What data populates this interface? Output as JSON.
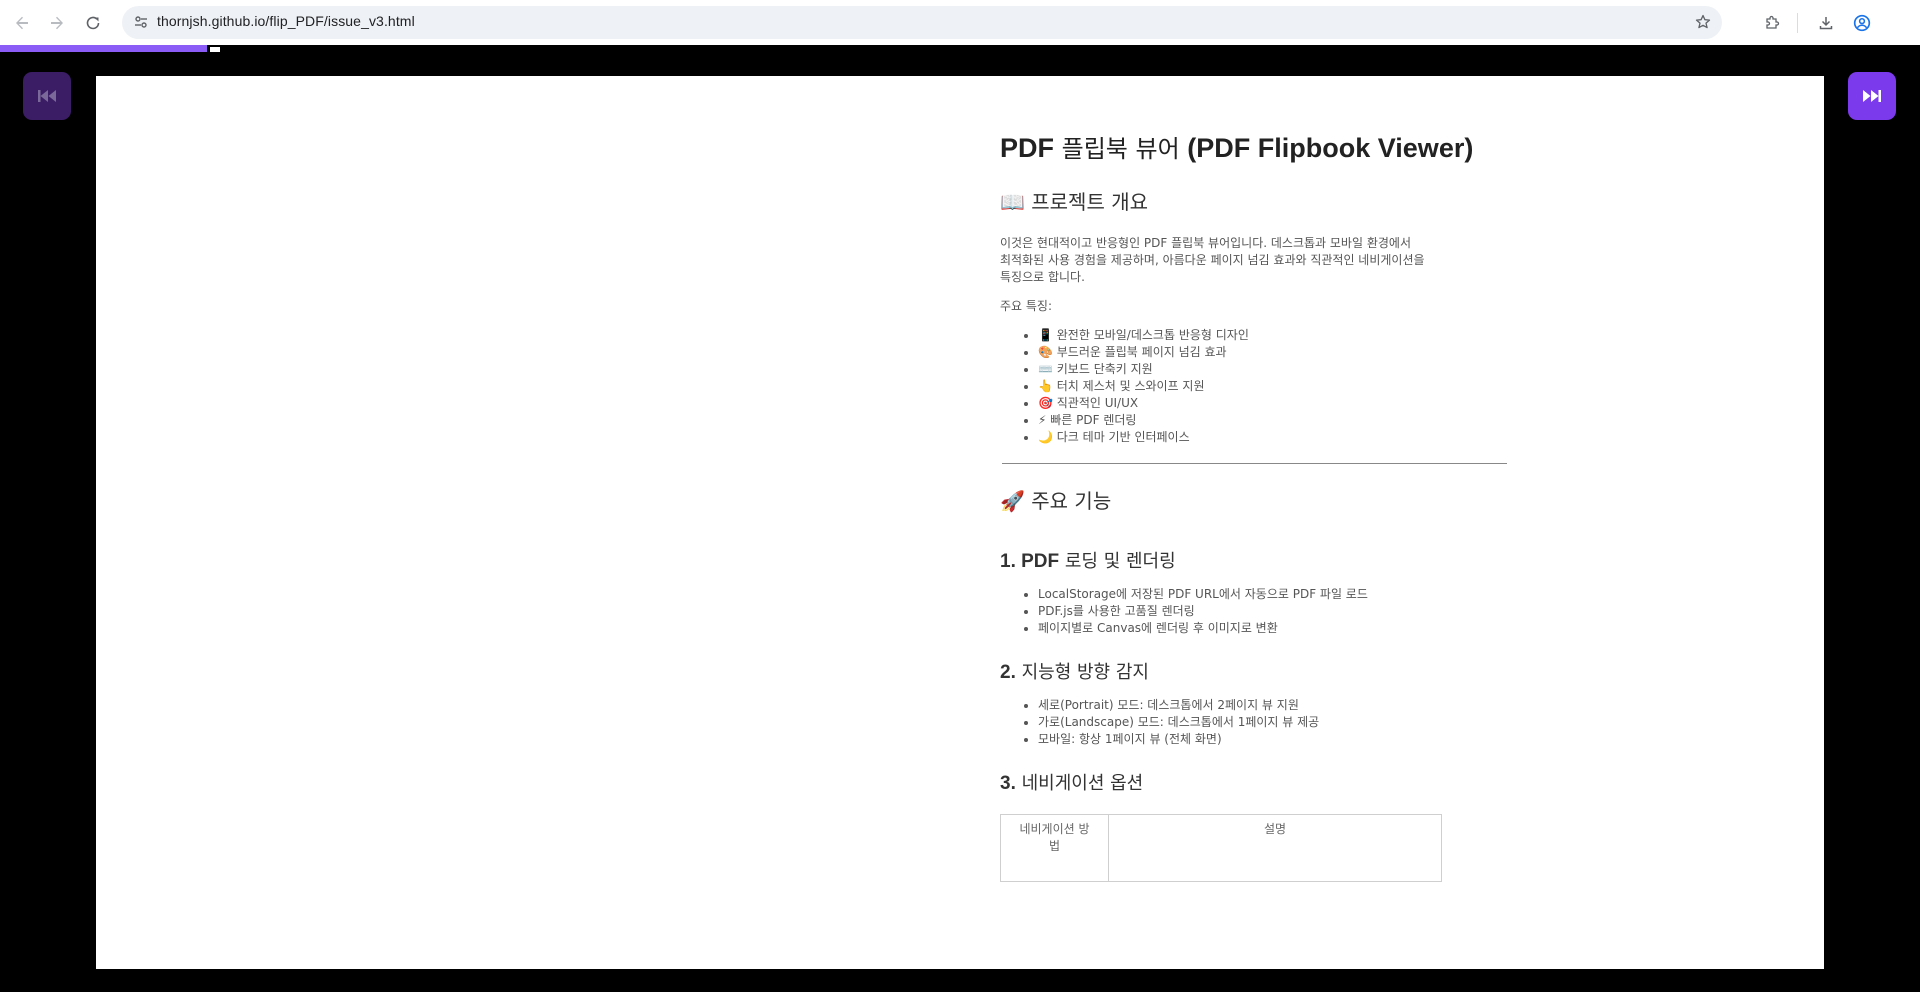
{
  "browser": {
    "url": "thornjsh.github.io/flip_PDF/issue_v3.html",
    "icons": {
      "back": "arrow-left-icon",
      "forward": "arrow-right-icon",
      "reload": "reload-icon",
      "site_info": "tune-icon",
      "bookmark": "star-icon",
      "extensions": "puzzle-icon",
      "downloads": "download-icon",
      "profile": "account-circle-icon"
    }
  },
  "progress": {
    "fraction": 0.108,
    "color": "#8b5cf6"
  },
  "controls": {
    "prev_icon": "skip-back-icon",
    "next_icon": "skip-forward-icon",
    "prev_color": "#3b1d66",
    "next_color": "#7c3aed"
  },
  "doc": {
    "title_bold_1": "PDF",
    "title_thin": " 플립북 뷰어 ",
    "title_bold_2": "(PDF Flipbook Viewer)",
    "overview_heading": "📖 프로젝트 개요",
    "intro_line_1": "이것은 현대적이고 반응형인 PDF 플립북 뷰어입니다. 데스크톱과 모바일 환경에서",
    "intro_line_2": "최적화된 사용 경험을 제공하며, 아름다운 페이지 넘김 효과와 직관적인 네비게이션을",
    "intro_line_3": "특징으로 합니다.",
    "features_label": "주요 특징:",
    "features": [
      "📱 완전한 모바일/데스크톱 반응형 디자인",
      "🎨 부드러운 플립북 페이지 넘김 효과",
      "⌨️ 키보드 단축키 지원",
      "👆 터치 제스처 및 스와이프 지원",
      "🎯 직관적인 UI/UX",
      "⚡ 빠른 PDF 렌더링",
      "🌙 다크 테마 기반 인터페이스"
    ],
    "main_heading": "🚀 주요 기능",
    "sec1_num": "1. PDF",
    "sec1_text": " 로딩 및 렌더링",
    "sec1_items": [
      "LocalStorage에 저장된 PDF URL에서 자동으로 PDF 파일 로드",
      "PDF.js를 사용한 고품질 렌더링",
      "페이지별로 Canvas에 렌더링 후 이미지로 변환"
    ],
    "sec2_num": "2.",
    "sec2_text": " 지능형 방향 감지",
    "sec2_items": [
      "세로(Portrait) 모드: 데스크톱에서 2페이지 뷰 지원",
      "가로(Landscape) 모드: 데스크톱에서 1페이지 뷰 제공",
      "모바일: 항상 1페이지 뷰 (전체 화면)"
    ],
    "sec3_num": "3.",
    "sec3_text": " 네비게이션 옵션",
    "table_headers": [
      "네비게이션 방법",
      "설명"
    ]
  }
}
